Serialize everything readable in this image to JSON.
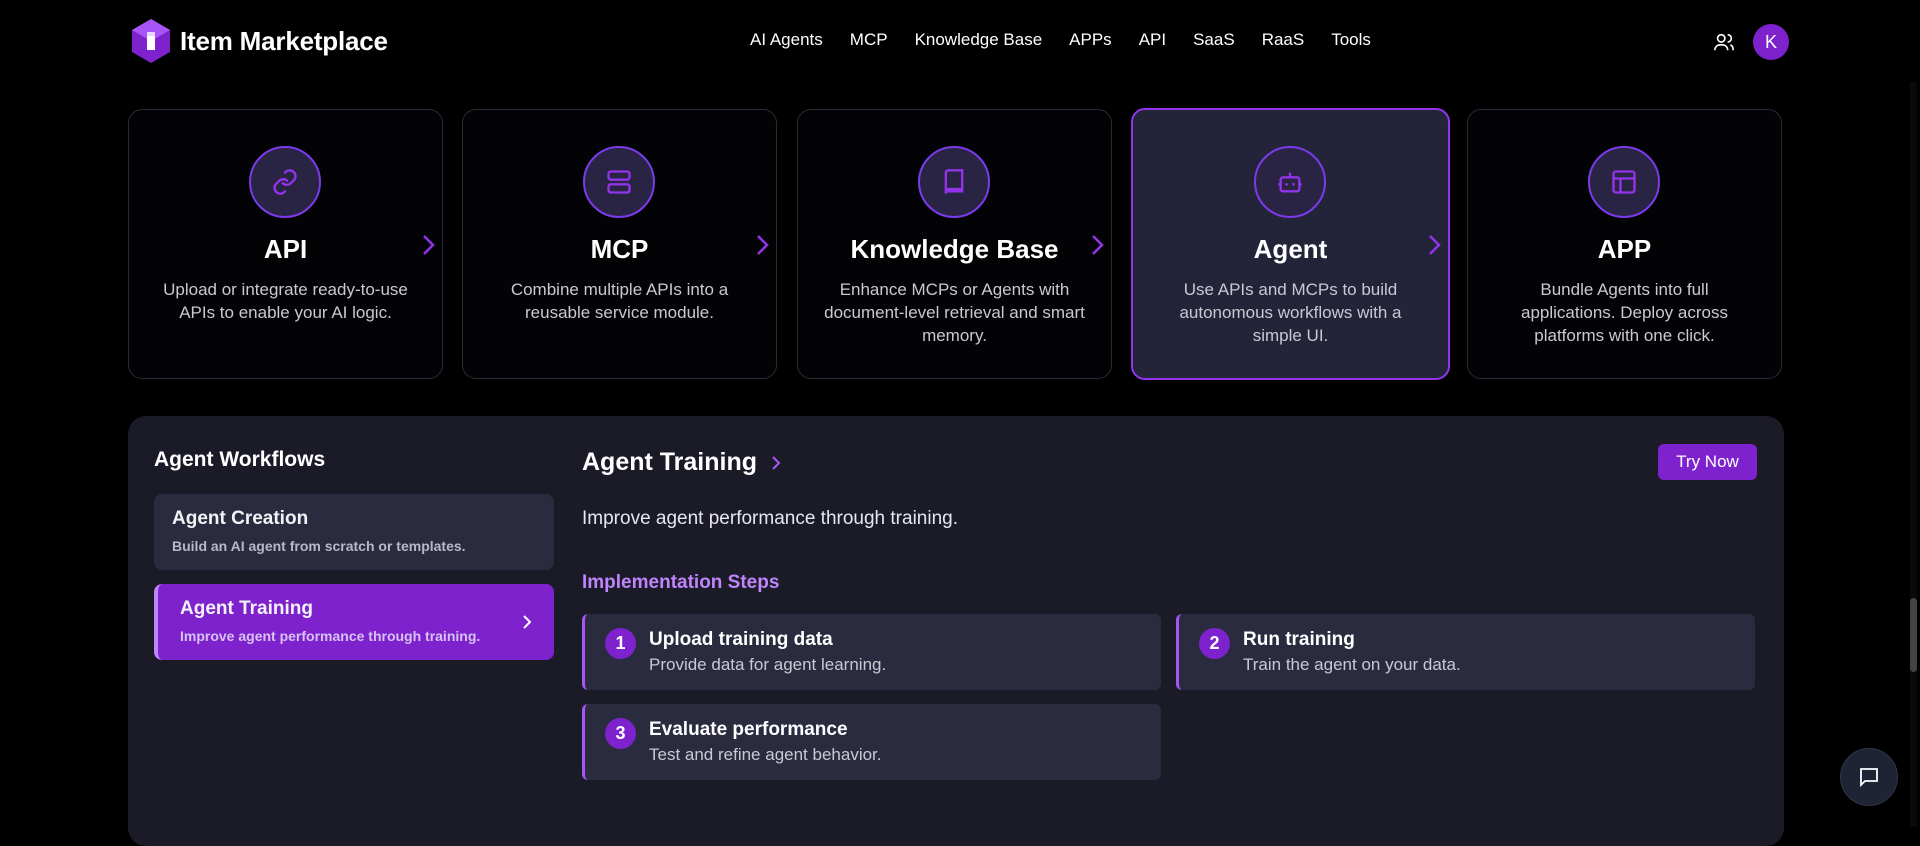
{
  "header": {
    "brand": "Item Marketplace",
    "nav": [
      "AI Agents",
      "MCP",
      "Knowledge Base",
      "APPs",
      "API",
      "SaaS",
      "RaaS",
      "Tools"
    ],
    "avatar_initial": "K",
    "icons": {
      "user": "users-icon",
      "logo": "hexagon-logo-icon"
    }
  },
  "cards": [
    {
      "title": "API",
      "desc": "Upload or integrate ready-to-use APIs to enable your AI logic.",
      "icon": "link-icon"
    },
    {
      "title": "MCP",
      "desc": "Combine multiple APIs into a reusable service module.",
      "icon": "server-icon"
    },
    {
      "title": "Knowledge Base",
      "desc": "Enhance MCPs or Agents with document-level retrieval and smart memory.",
      "icon": "book-icon"
    },
    {
      "title": "Agent",
      "desc": "Use APIs and MCPs to build autonomous workflows with a simple UI.",
      "icon": "bot-icon",
      "active": true
    },
    {
      "title": "APP",
      "desc": "Bundle Agents into full applications. Deploy across platforms with one click.",
      "icon": "layout-icon"
    }
  ],
  "workflows": {
    "title": "Agent Workflows",
    "items": [
      {
        "title": "Agent Creation",
        "desc": "Build an AI agent from scratch or templates."
      },
      {
        "title": "Agent Training",
        "desc": "Improve agent performance through training.",
        "selected": true
      }
    ]
  },
  "detail": {
    "title": "Agent Training",
    "try_label": "Try Now",
    "desc": "Improve agent performance through training.",
    "steps_title": "Implementation Steps",
    "steps": [
      {
        "num": "1",
        "title": "Upload training data",
        "desc": "Provide data for agent learning."
      },
      {
        "num": "2",
        "title": "Run training",
        "desc": "Train the agent on your data."
      },
      {
        "num": "3",
        "title": "Evaluate performance",
        "desc": "Test and refine agent behavior."
      }
    ]
  },
  "colors": {
    "accent": "#7e22ce",
    "accent_light": "#c084fc",
    "panel": "#1b1b28"
  }
}
